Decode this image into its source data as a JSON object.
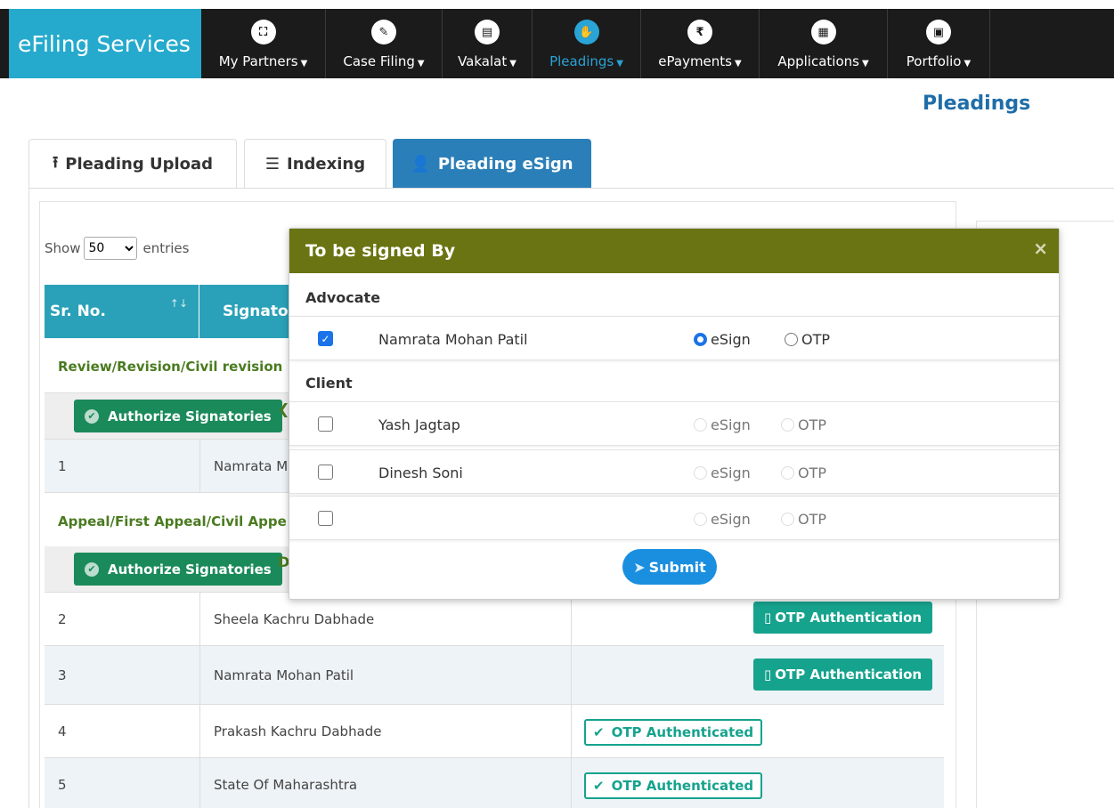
{
  "brand": "eFiling Services",
  "nav": [
    {
      "label": "My Partners",
      "icon": "partners-icon",
      "glyph": "⛶"
    },
    {
      "label": "Case Filing",
      "icon": "pencil-icon",
      "glyph": "✎"
    },
    {
      "label": "Vakalat",
      "icon": "document-icon",
      "glyph": "▤"
    },
    {
      "label": "Pleadings",
      "icon": "hands-icon",
      "glyph": "✋"
    },
    {
      "label": "ePayments",
      "icon": "rupee-icon",
      "glyph": "₹"
    },
    {
      "label": "Applications",
      "icon": "file-icon",
      "glyph": "▦"
    },
    {
      "label": "Portfolio",
      "icon": "briefcase-icon",
      "glyph": "▣"
    }
  ],
  "page_title": "Pleadings",
  "tabs": [
    {
      "label": "Pleading Upload",
      "icon": "upload-icon"
    },
    {
      "label": "Indexing",
      "icon": "list-icon"
    },
    {
      "label": "Pleading eSign",
      "icon": "user-check-icon"
    }
  ],
  "show_entries": {
    "prefix": "Show",
    "value": "50",
    "suffix": "entries"
  },
  "table": {
    "headers": [
      "Sr. No.",
      "Signator"
    ],
    "groups": [
      {
        "title": "Review/Revision/Civil revision",
        "button": "Authorize Signatories"
      },
      {
        "title": "Appeal/First Appeal/Civil Appe",
        "button": "Authorize Signatories",
        "trail": "D"
      }
    ],
    "rows": [
      {
        "no": "1",
        "name": "Namrata M"
      },
      {
        "no": "2",
        "name": "Sheela Kachru Dabhade",
        "status": "OTP Authentication"
      },
      {
        "no": "3",
        "name": "Namrata Mohan Patil",
        "status": "OTP Authentication"
      },
      {
        "no": "4",
        "name": "Prakash Kachru Dabhade",
        "status": "OTP Authenticated"
      },
      {
        "no": "5",
        "name": "State Of Maharashtra",
        "status": "OTP Authenticated"
      }
    ]
  },
  "modal": {
    "title": "To be signed By",
    "close": "×",
    "advocate_label": "Advocate",
    "client_label": "Client",
    "esign_label": "eSign",
    "otp_label": "OTP",
    "advocates": [
      {
        "name": "Namrata Mohan Patil",
        "checked": true,
        "mode": "eSign"
      }
    ],
    "clients": [
      {
        "name": "Yash Jagtap",
        "checked": false
      },
      {
        "name": "Dinesh Soni",
        "checked": false
      },
      {
        "name": "",
        "checked": false
      }
    ],
    "submit": "Submit"
  }
}
